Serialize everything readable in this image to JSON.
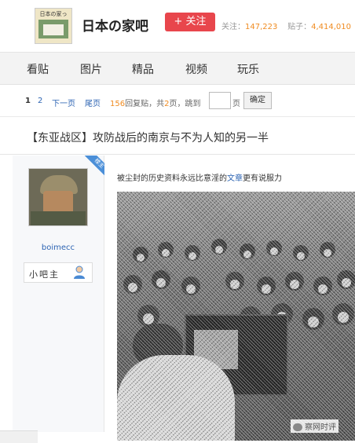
{
  "header": {
    "logo_text": "日本の家っ",
    "forum_name": "日本の家吧",
    "follow_label": "+ 关注",
    "followers_label": "关注：",
    "followers_value": "147,223",
    "posts_label": "贴子：",
    "posts_value": "4,414,010"
  },
  "nav": {
    "items": [
      "看贴",
      "图片",
      "精品",
      "视频",
      "玩乐"
    ]
  },
  "pager": {
    "page_1": "1",
    "page_2": "2",
    "next": "下一页",
    "last": "尾页",
    "reply_count": "156",
    "reply_label": "回复贴，共",
    "total_pages": "2",
    "pages_label": "页，跳到",
    "page_unit": "页",
    "confirm": "确定"
  },
  "post": {
    "title": "【东亚战区】攻防战后的南京与不为人知的另一半",
    "text_before": "被尘封的历史资料永远比意淫的",
    "text_link": "文章",
    "text_after": "更有说服力"
  },
  "author": {
    "username": "boimecc",
    "badge": "小吧主",
    "ribbon": "楼主"
  },
  "watermark": "察网时评",
  "colors": {
    "accent_orange": "#f08c22",
    "follow_red": "#e8464c",
    "link_blue": "#2d64b3",
    "ribbon_blue": "#4b8fd8"
  },
  "icons": {
    "badge_icon": "user-icon",
    "watermark_icon": "wechat-icon"
  }
}
